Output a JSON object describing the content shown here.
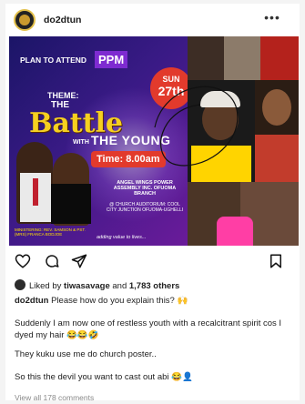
{
  "post": {
    "username": "do2dtun",
    "more_glyph": "•••",
    "poster": {
      "plan_text": "PLAN TO ATTEND",
      "ppm": "PPM",
      "theme_label": "THEME:",
      "title_the": "THE",
      "title_battle": "Battle",
      "title_with": "WITH",
      "title_young": "THE YOUNG",
      "date_day": "SUN",
      "date_num": "27th",
      "time": "Time: 8.00am",
      "ministering": "MINISTERING: REV. SAMSON & PST. (MRS) FRANCA BODJOE",
      "church_name": "ANGEL WINGS POWER ASSEMBLY INC. OFUOMA BRANCH",
      "church_address": "@ CHURCH AUDITORIUM: COOL CITY JUNCTION OFUOMA-UGHELLI",
      "footer": "adding value to lives..."
    },
    "icons": {
      "like": "heart-icon",
      "comment": "comment-icon",
      "share": "share-icon",
      "save": "bookmark-icon",
      "more": "more-horizontal-icon"
    },
    "likes": {
      "prefix": "Liked by ",
      "user": "tiwasavage",
      "middle": " and ",
      "count": "1,783 others"
    },
    "caption": {
      "author": "do2dtun",
      "text": " Please how do you explain this? 🙌"
    },
    "paragraphs": [
      "Suddenly I am now one of restless youth with a recalcitrant spirit cos I dyed my hair 😂😂🤣",
      "They kuku use me do church poster..",
      "So this the devil you want to cast out abi 😂👤",
      "View all 178 comments"
    ]
  }
}
